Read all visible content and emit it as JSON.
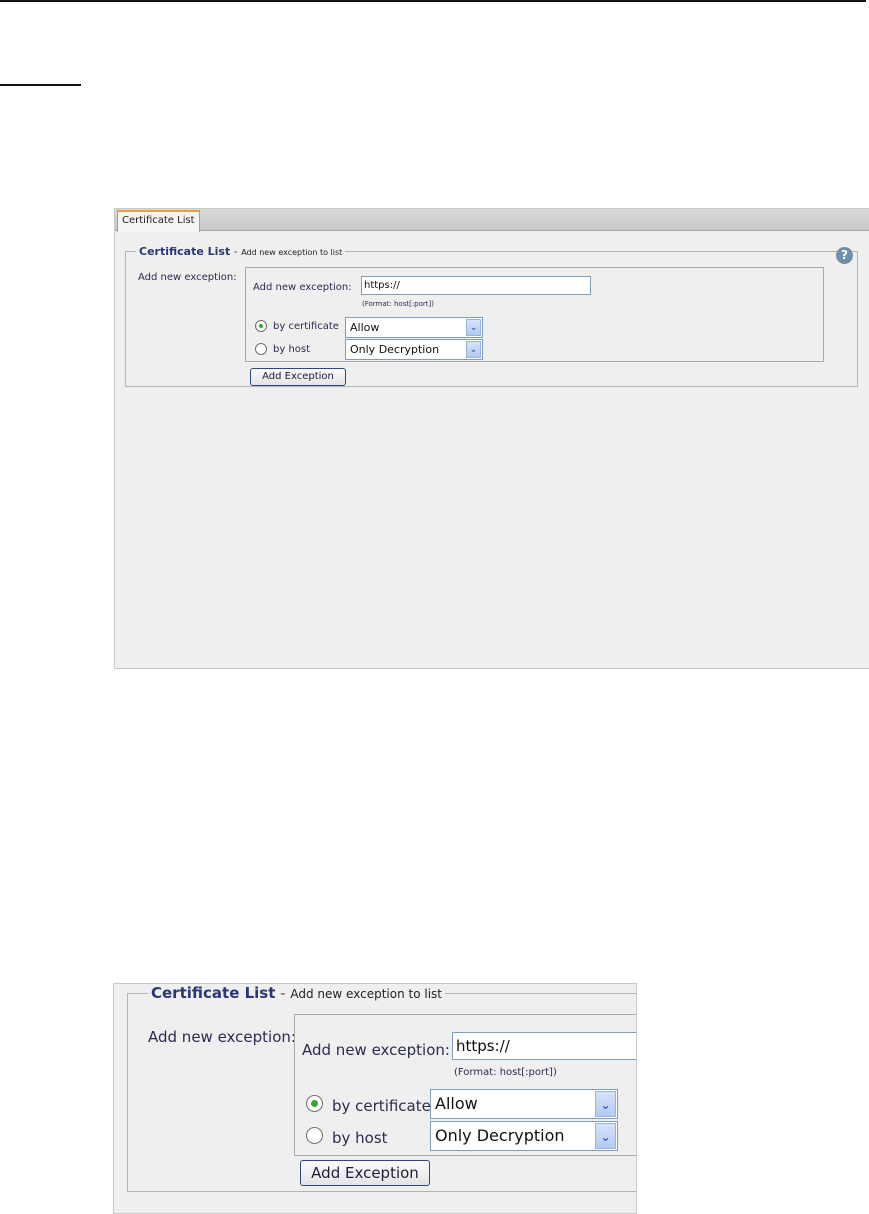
{
  "tab": {
    "label": "Certificate List"
  },
  "section": {
    "title": "Certificate List",
    "separator": "-",
    "subtitle": "Add new exception to list"
  },
  "help_icon": {
    "glyph": "?"
  },
  "form": {
    "row_label": "Add new exception:",
    "url_label": "Add new exception:",
    "url_value": "https://",
    "format_hint": "(Format: host[:port])",
    "radio_certificate": {
      "label": "by certificate",
      "checked": true
    },
    "radio_host": {
      "label": "by host",
      "checked": false
    },
    "select_certificate": {
      "value": "Allow"
    },
    "select_host": {
      "value": "Only Decryption"
    },
    "add_button": "Add Exception"
  },
  "colors": {
    "tab_accent": "#e8a23c",
    "title_text": "#2a3676",
    "radio_dot": "#3ba03b",
    "help_icon": "#6f8eac",
    "select_arrow": "#b3c9f1"
  }
}
